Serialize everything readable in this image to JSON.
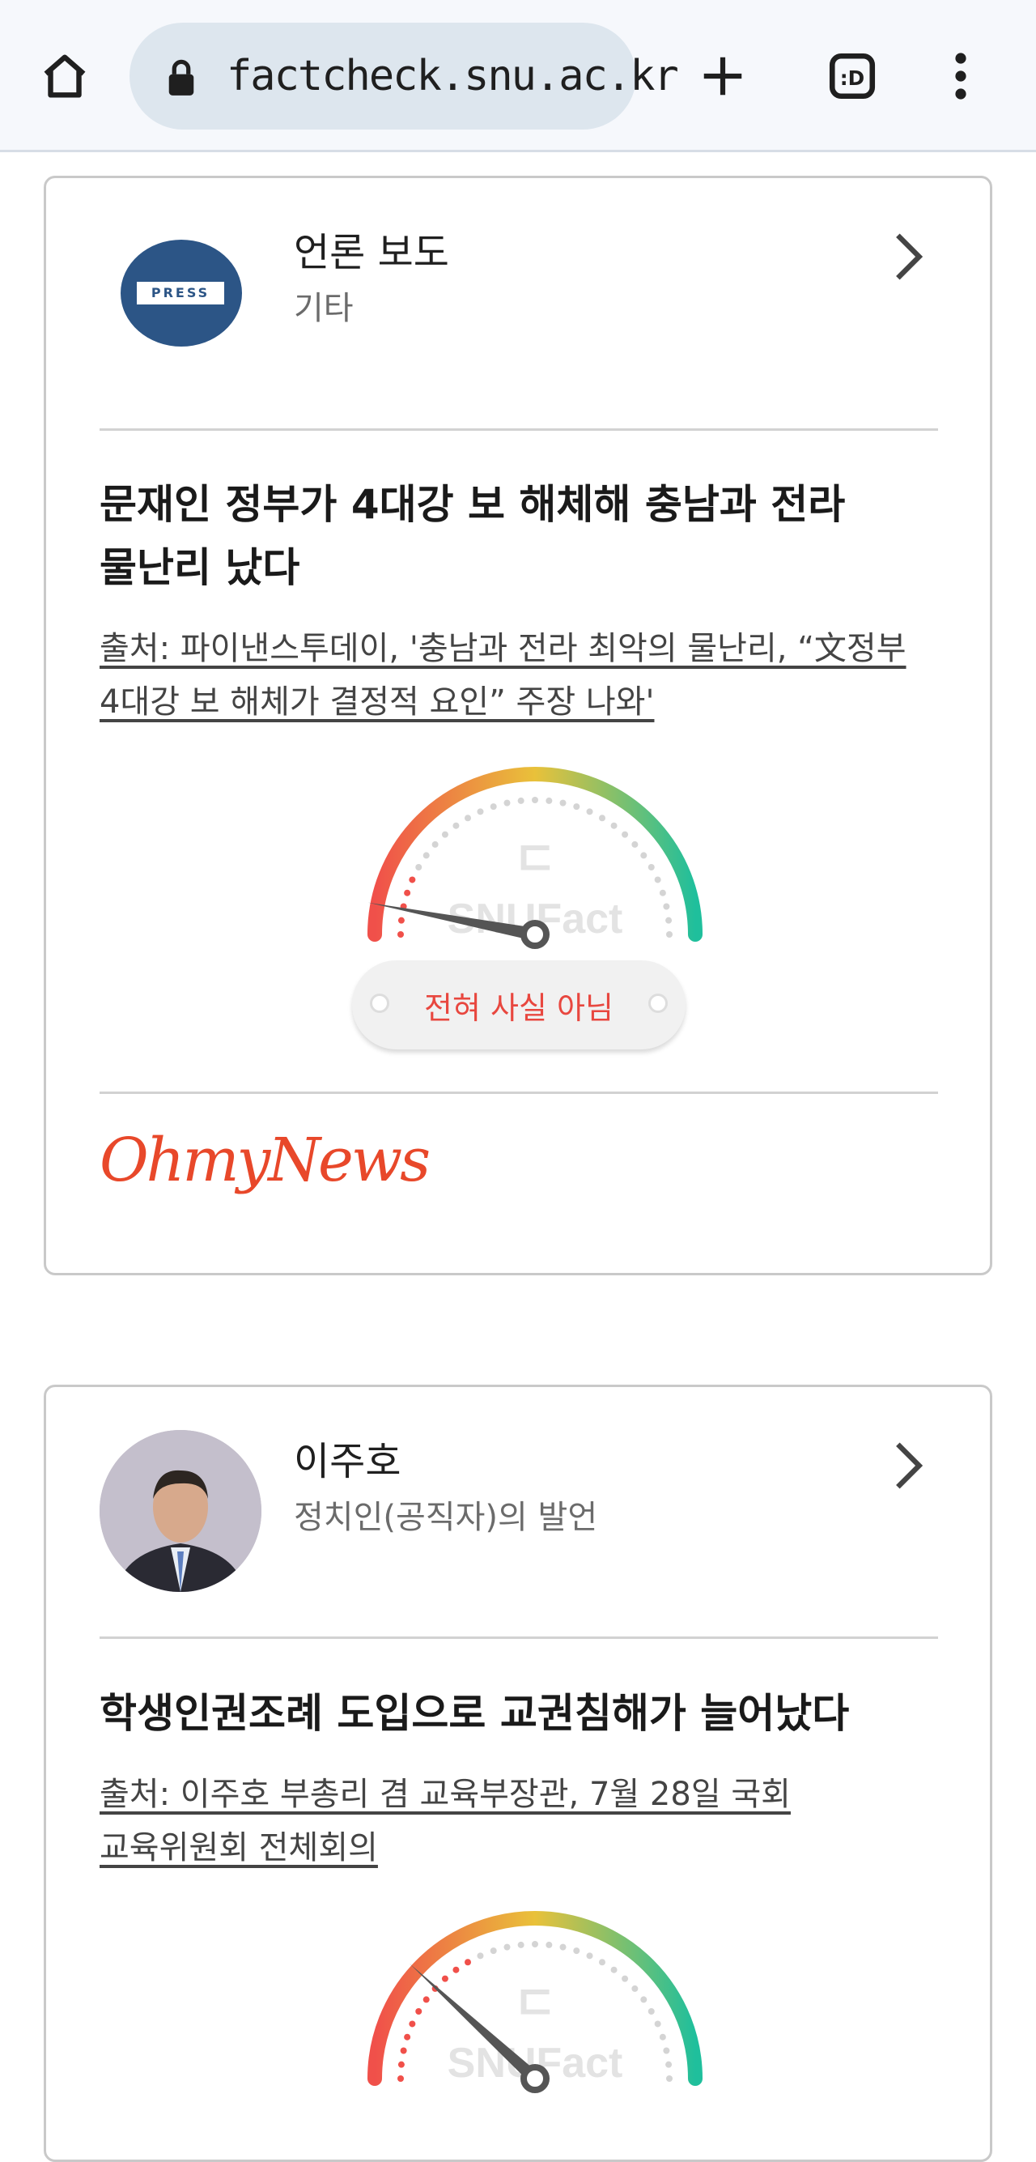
{
  "browser": {
    "url": "factcheck.snu.ac.kr",
    "icons": [
      "home-icon",
      "lock-icon",
      "plus-icon",
      "tab-switcher-icon",
      "more-vert-icon"
    ]
  },
  "cards": [
    {
      "speaker_name": "언론 보도",
      "speaker_category": "기타",
      "avatar_label": "PRESS",
      "claim_lines": [
        "문재인 정부가 4대강 보 해체해 충남과 전라",
        "물난리 났다"
      ],
      "source_lines": [
        "출처: 파이낸스투데이, '충남과 전라 최악의 물난리, “文정부",
        "4대강 보 해체가 결정적 요인” 주장 나와'"
      ],
      "gauge_watermark": "SNUFact",
      "verdict": "전혀 사실 아님",
      "verdict_level": 0.0,
      "media_name": "OhmyNews"
    },
    {
      "speaker_name": "이주호",
      "speaker_category": "정치인(공직자)의 발언",
      "claim_lines": [
        "학생인권조례 도입으로 교권침해가 늘어났다"
      ],
      "source_lines": [
        "출처: 이주호 부총리 겸 교육부장관, 7월 28일 국회",
        "교육위원회 전체회의"
      ],
      "gauge_watermark": "SNUFact",
      "verdict_level": 0.2
    }
  ],
  "colors": {
    "gauge_red": "#f0504a",
    "gauge_yellow": "#e9c13a",
    "gauge_green": "#1fbf9c",
    "verdict_red": "#e8473f",
    "press_blue": "#2c5586",
    "ohmynews_orange": "#e8482a"
  }
}
